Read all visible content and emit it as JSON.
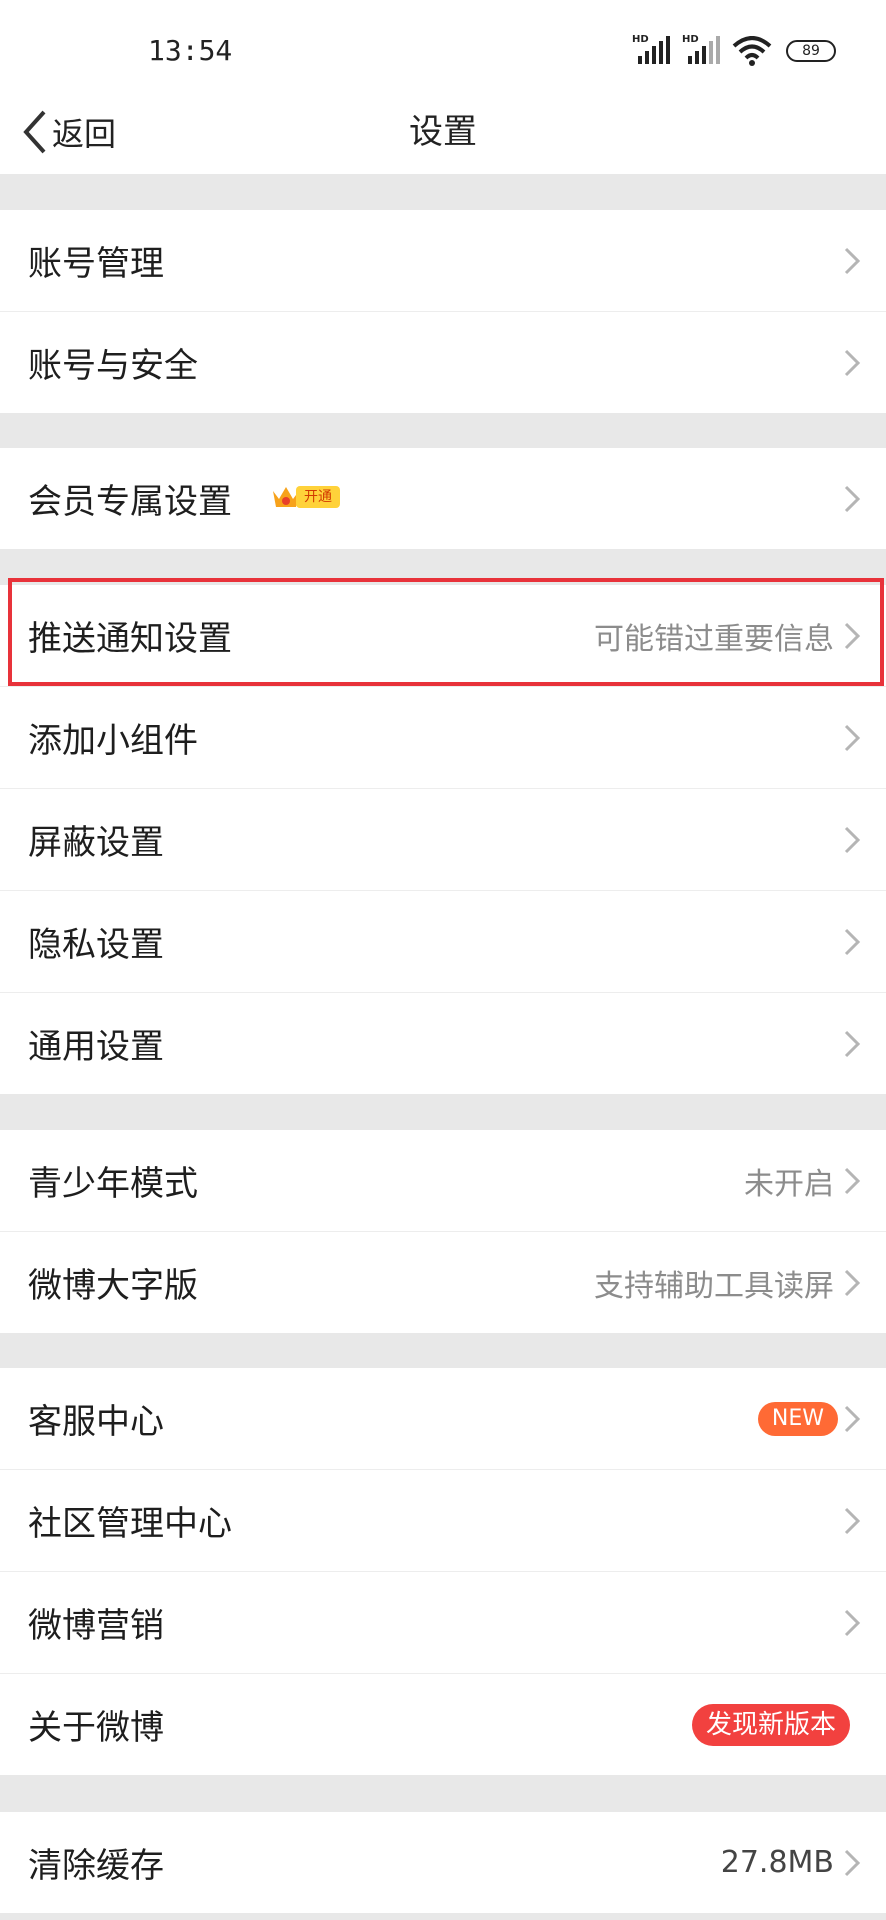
{
  "status_bar": {
    "time": "13:54",
    "battery": "89",
    "signal1": "HD",
    "signal2": "HD"
  },
  "nav": {
    "back_label": "返回",
    "title": "设置"
  },
  "groups": [
    {
      "items": [
        {
          "label": "账号管理"
        },
        {
          "label": "账号与安全"
        }
      ]
    },
    {
      "items": [
        {
          "label": "会员专属设置",
          "badge": "开通"
        }
      ]
    },
    {
      "items": [
        {
          "label": "推送通知设置",
          "value": "可能错过重要信息"
        },
        {
          "label": "添加小组件"
        },
        {
          "label": "屏蔽设置"
        },
        {
          "label": "隐私设置"
        },
        {
          "label": "通用设置"
        }
      ]
    },
    {
      "items": [
        {
          "label": "青少年模式",
          "value": "未开启"
        },
        {
          "label": "微博大字版",
          "value": "支持辅助工具读屏"
        }
      ]
    },
    {
      "items": [
        {
          "label": "客服中心",
          "badge": "NEW"
        },
        {
          "label": "社区管理中心"
        },
        {
          "label": "微博营销"
        },
        {
          "label": "关于微博",
          "badge": "发现新版本"
        }
      ]
    },
    {
      "items": [
        {
          "label": "清除缓存",
          "value": "27.8MB"
        }
      ]
    }
  ],
  "colors": {
    "accent_red": "#f2413f",
    "new_orange": "#ff6a35",
    "highlight_border": "#e8323a"
  }
}
